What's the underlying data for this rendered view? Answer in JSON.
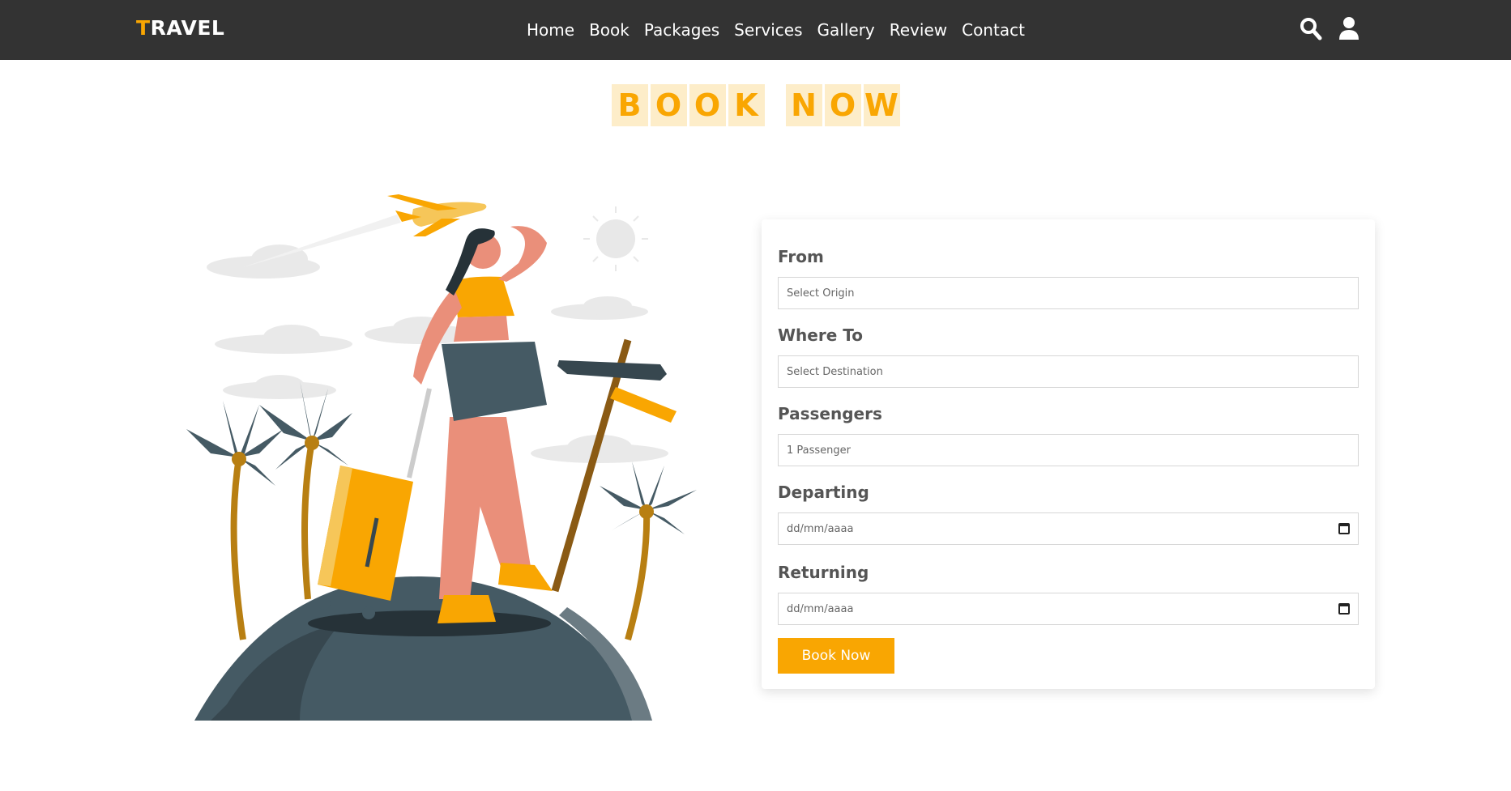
{
  "brand": {
    "logo_first": "T",
    "logo_rest": "RAVEL",
    "accent_color": "#f9a602"
  },
  "nav": {
    "items": [
      "Home",
      "Book",
      "Packages",
      "Services",
      "Gallery",
      "Review",
      "Contact"
    ],
    "icons": [
      "search-icon",
      "user-icon"
    ]
  },
  "heading": {
    "word1": [
      "B",
      "O",
      "O",
      "K"
    ],
    "word2": [
      "N",
      "O",
      "W"
    ]
  },
  "form": {
    "from_label": "From",
    "from_placeholder": "Select Origin",
    "to_label": "Where To",
    "to_placeholder": "Select Destination",
    "passengers_label": "Passengers",
    "passengers_placeholder": "1 Passenger",
    "departing_label": "Departing",
    "departing_value": "dd/mm/aaaa",
    "returning_label": "Returning",
    "returning_value": "dd/mm/aaaa",
    "submit_label": "Book Now"
  },
  "colors": {
    "header_bg": "#333333",
    "accent": "#f9a602",
    "letter_bg": "#fdedc9"
  }
}
